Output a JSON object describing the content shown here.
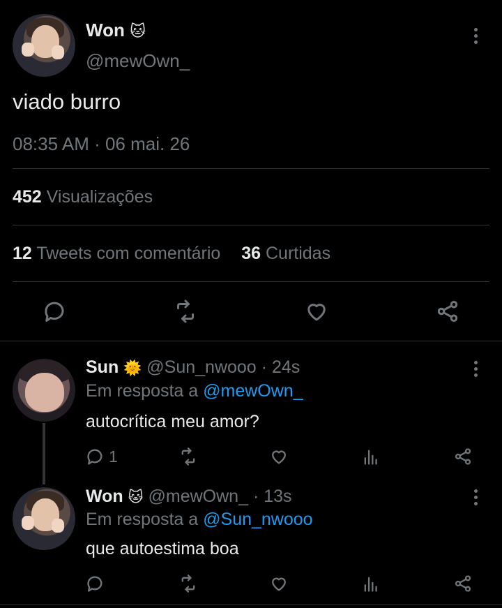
{
  "main_tweet": {
    "author_name": "Won",
    "author_emoji": "🐱",
    "author_handle": "@mewOwn_",
    "text": "viado burro",
    "timestamp": "08:35 AM · 06 mai. 26",
    "views_count": "452",
    "views_label": "Visualizações",
    "quote_count": "12",
    "quote_label": "Tweets com comentário",
    "likes_count": "36",
    "likes_label": "Curtidas"
  },
  "replies": [
    {
      "author_name": "Sun",
      "author_emoji": "🌞",
      "author_handle": "@Sun_nwooo",
      "time": "· 24s",
      "reply_prefix": "Em resposta a",
      "reply_to": "@mewOwn_",
      "text": "autocrítica meu amor?",
      "reply_count": "1"
    },
    {
      "author_name": "Won",
      "author_emoji": "🐱",
      "author_handle": "@mewOwn_",
      "time": "· 13s",
      "reply_prefix": "Em resposta a",
      "reply_to": "@Sun_nwooo",
      "text": "que autoestima boa",
      "reply_count": ""
    }
  ],
  "colors": {
    "background": "#000000",
    "text": "#e7e9ea",
    "muted": "#71767b",
    "link": "#1d9bf0",
    "divider": "#2f3336"
  }
}
